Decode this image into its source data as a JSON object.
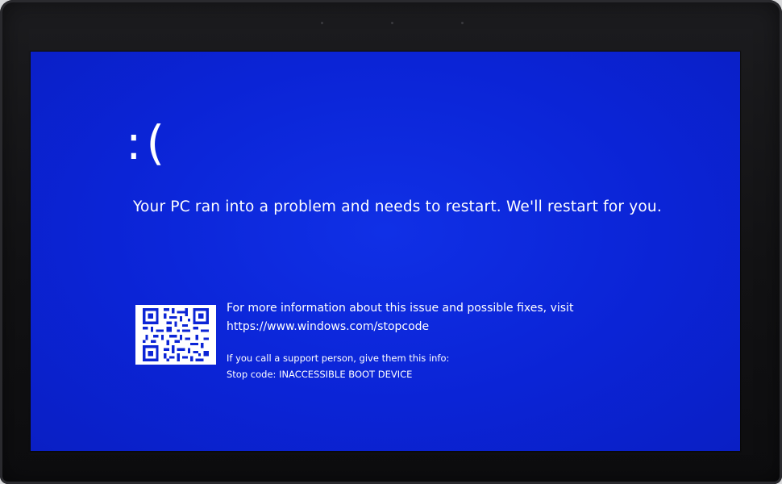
{
  "bsod": {
    "sad_face": ":(",
    "headline": "Your PC ran into a problem and needs to restart. We'll restart for you.",
    "info_text": "For more information about this issue and possible fixes, visit",
    "info_url": "https://www.windows.com/stopcode",
    "support_text": "If you call a support person, give them this info:",
    "stop_code": "Stop code: INACCESSIBLE BOOT DEVICE"
  },
  "colors": {
    "screen_background": "#0b24d6",
    "text": "#ffffff",
    "bezel": "#141416"
  },
  "icons": {
    "qr_code": "qr-code-icon"
  }
}
